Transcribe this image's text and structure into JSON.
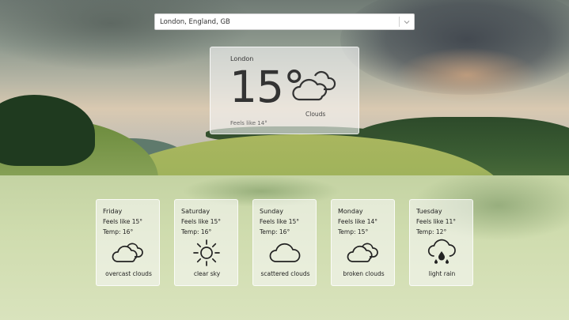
{
  "search": {
    "value": "London, England, GB",
    "dropdown_icon": "chevron-down-icon"
  },
  "current": {
    "city": "London",
    "temperature": "15°",
    "feels_like": "Feels like 14°",
    "description": "Clouds",
    "icon": "clouds-icon"
  },
  "forecast": [
    {
      "day": "Friday",
      "feels_like": "Feels like 15°",
      "temp": "Temp: 16°",
      "description": "overcast clouds",
      "icon": "overcast-clouds-icon"
    },
    {
      "day": "Saturday",
      "feels_like": "Feels like 15°",
      "temp": "Temp: 16°",
      "description": "clear sky",
      "icon": "sun-icon"
    },
    {
      "day": "Sunday",
      "feels_like": "Feels like 15°",
      "temp": "Temp: 16°",
      "description": "scattered clouds",
      "icon": "cloud-icon"
    },
    {
      "day": "Monday",
      "feels_like": "Feels like 14°",
      "temp": "Temp: 15°",
      "description": "broken clouds",
      "icon": "broken-clouds-icon"
    },
    {
      "day": "Tuesday",
      "feels_like": "Feels like 11°",
      "temp": "Temp: 12°",
      "description": "light rain",
      "icon": "rain-icon"
    }
  ]
}
